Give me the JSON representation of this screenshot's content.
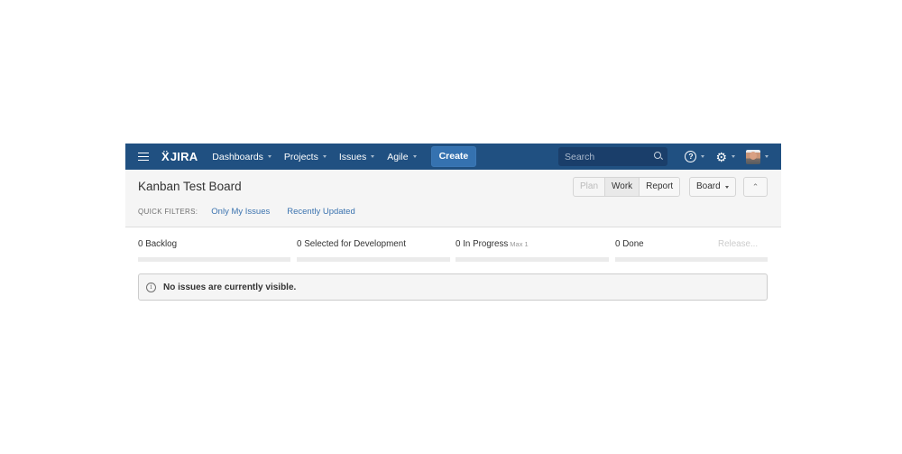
{
  "nav": {
    "logo": "JIRA",
    "items": [
      {
        "label": "Dashboards"
      },
      {
        "label": "Projects"
      },
      {
        "label": "Issues"
      },
      {
        "label": "Agile"
      }
    ],
    "create_label": "Create",
    "search_placeholder": "Search",
    "help_glyph": "?",
    "settings_glyph": "⚙"
  },
  "header": {
    "board_title": "Kanban Test Board",
    "quick_filters_label": "QUICK FILTERS:",
    "quick_filters": [
      {
        "label": "Only My Issues"
      },
      {
        "label": "Recently Updated"
      }
    ],
    "modes": [
      {
        "label": "Plan",
        "state": "disabled"
      },
      {
        "label": "Work",
        "state": "active"
      },
      {
        "label": "Report",
        "state": "normal"
      }
    ],
    "board_menu_label": "Board",
    "collapse_glyph": "⌃"
  },
  "columns": [
    {
      "count": "0",
      "name": "Backlog",
      "max": ""
    },
    {
      "count": "0",
      "name": "Selected for Development",
      "max": ""
    },
    {
      "count": "0",
      "name": "In Progress",
      "max": "Max 1"
    },
    {
      "count": "0",
      "name": "Done",
      "max": ""
    }
  ],
  "release_label": "Release...",
  "message": {
    "icon_glyph": "i",
    "text": "No issues are currently visible."
  }
}
